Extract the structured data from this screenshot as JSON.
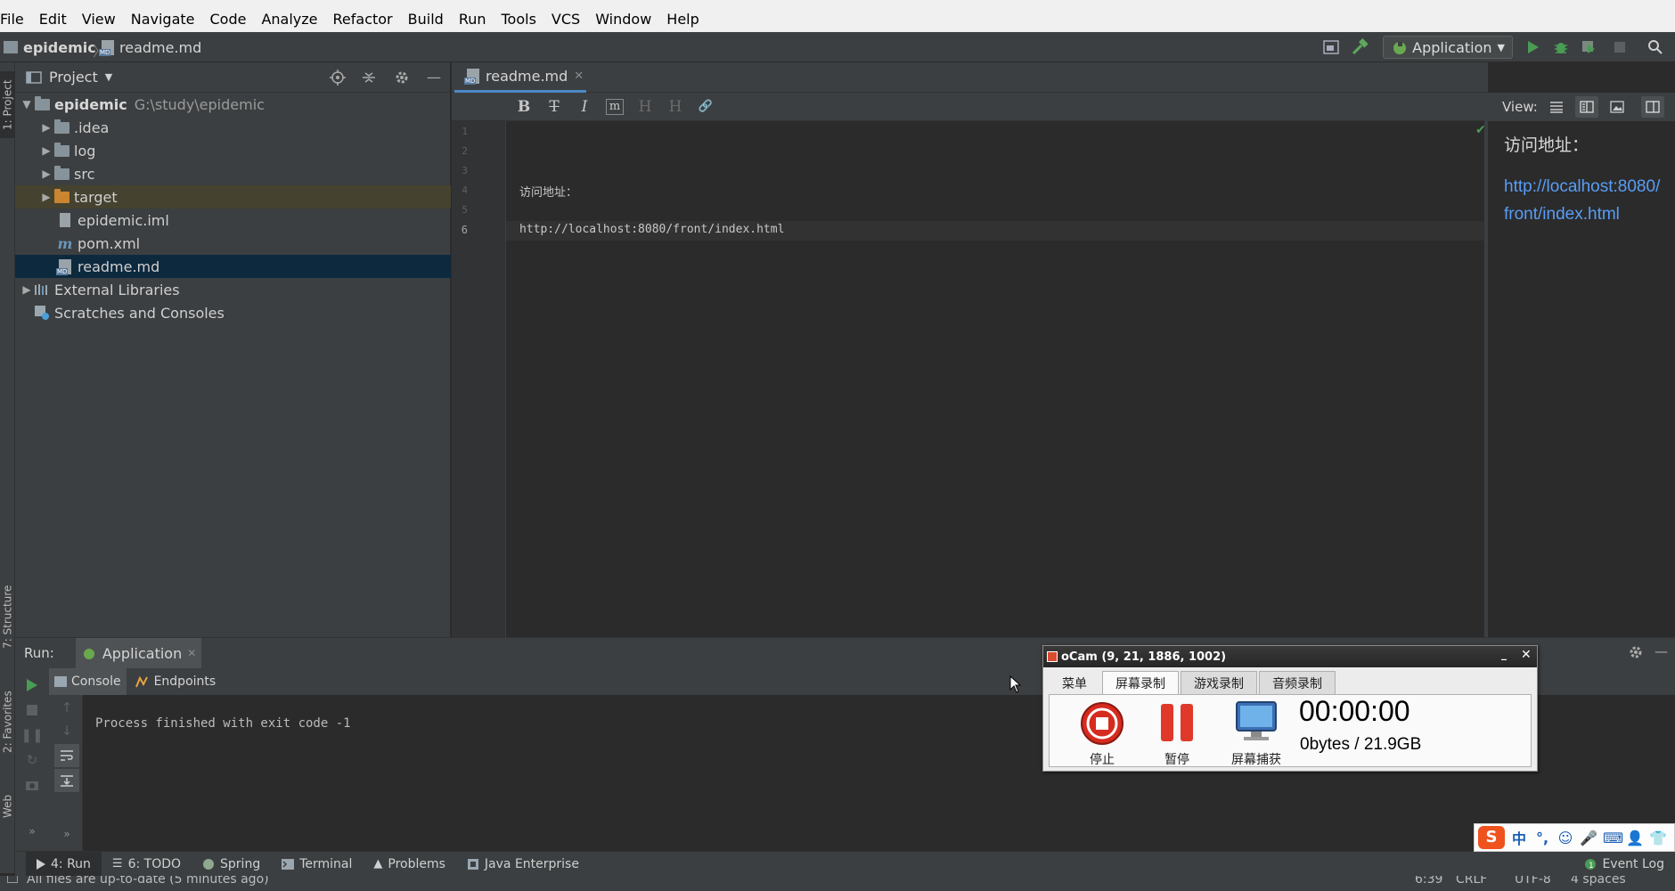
{
  "menu": [
    "File",
    "Edit",
    "View",
    "Navigate",
    "Code",
    "Analyze",
    "Refactor",
    "Build",
    "Run",
    "Tools",
    "VCS",
    "Window",
    "Help"
  ],
  "breadcrumb": {
    "project": "epidemic",
    "file": "readme.md"
  },
  "toolbar": {
    "run_config": "Application"
  },
  "left_stripe": {
    "project": "1: Project",
    "structure": "7: Structure",
    "favorites": "2: Favorites",
    "web": "Web"
  },
  "project_panel": {
    "title": "Project",
    "root": {
      "name": "epidemic",
      "path": "G:\\study\\epidemic"
    },
    "items": [
      {
        "label": ".idea"
      },
      {
        "label": "log"
      },
      {
        "label": "src"
      },
      {
        "label": "target"
      },
      {
        "label": "epidemic.iml"
      },
      {
        "label": "pom.xml"
      },
      {
        "label": "readme.md"
      }
    ],
    "external_libraries": "External Libraries",
    "scratches": "Scratches and Consoles"
  },
  "editor": {
    "tab": "readme.md",
    "line_numbers": [
      "1",
      "2",
      "3",
      "4",
      "5",
      "6"
    ],
    "lines": [
      "",
      "",
      "",
      "访问地址：",
      "",
      "http://localhost:8080/front/index.html"
    ],
    "toolbar": [
      "B",
      "T",
      "I",
      "m",
      "H",
      "H",
      "🔗"
    ]
  },
  "preview": {
    "view_label": "View:",
    "heading": "访问地址：",
    "link": "http://localhost:8080/front/index.html",
    "link_line1": "http://localhost:8080/",
    "link_line2": "front/index.html"
  },
  "run_panel": {
    "label": "Run:",
    "tab": "Application",
    "subtabs": [
      "Console",
      "Endpoints"
    ],
    "output": "Process finished with exit code -1"
  },
  "bottom_tabs": [
    "4: Run",
    "6: TODO",
    "Spring",
    "Terminal",
    "Problems",
    "Java Enterprise"
  ],
  "event_log": "Event Log",
  "status": {
    "message": "All files are up-to-date (5 minutes ago)",
    "position": "6:39",
    "line_sep": "CRLF",
    "encoding": "UTF-8",
    "indent": "4 spaces"
  },
  "ocam": {
    "title": "oCam (9, 21, 1886, 1002)",
    "tabs": [
      "菜单",
      "屏幕录制",
      "游戏录制",
      "音频录制"
    ],
    "actions": [
      "停止",
      "暂停",
      "屏幕捕获"
    ],
    "timer": "00:00:00",
    "size": "0bytes / 21.9GB"
  },
  "ime": {
    "mode": "中",
    "punct": "°,"
  },
  "colors": {
    "accent": "#4a88c7",
    "link": "#589df6",
    "selection": "#0d293e",
    "run_green": "#499c54"
  }
}
